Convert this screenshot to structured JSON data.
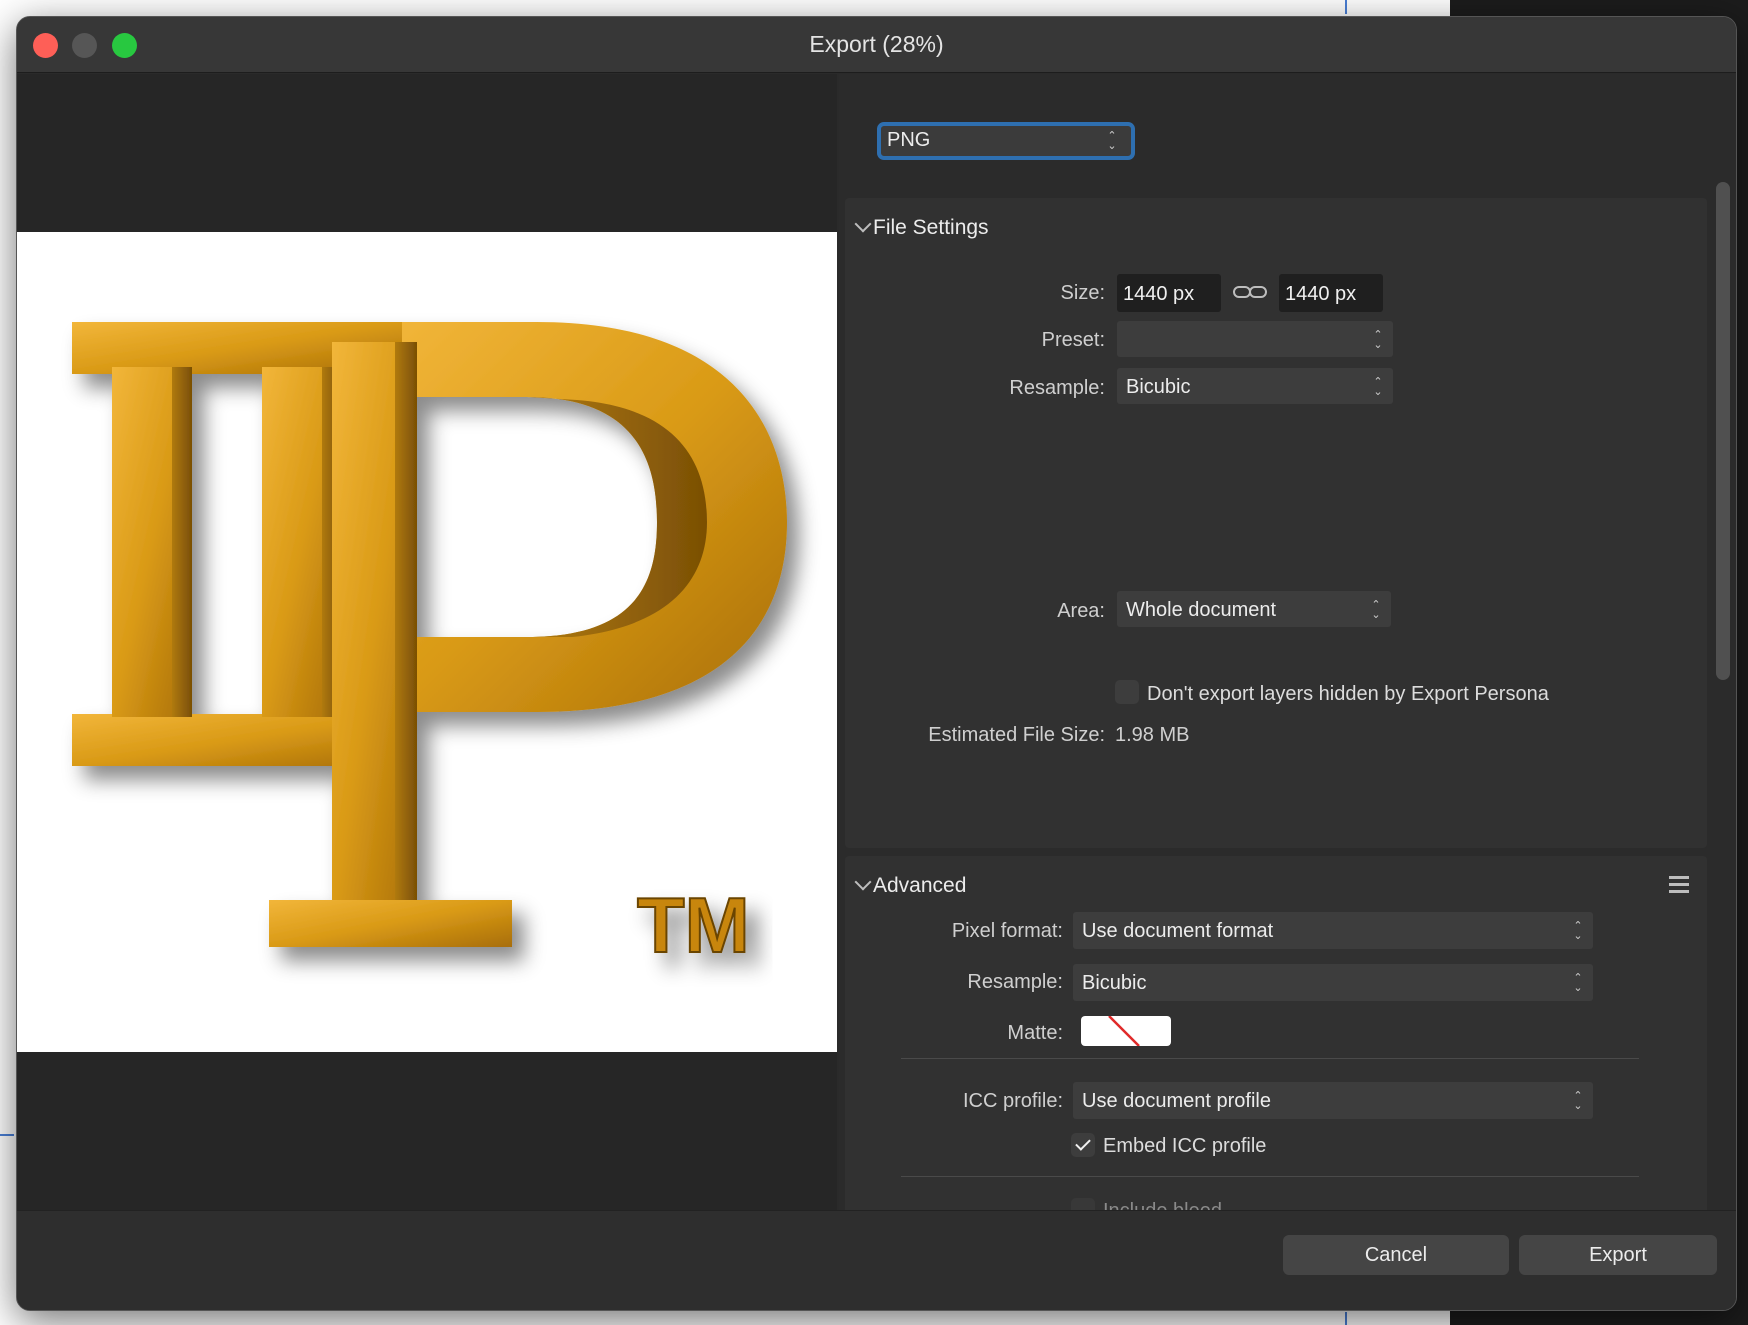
{
  "window": {
    "title": "Export (28%)"
  },
  "preview": {
    "logo_letters": "IP",
    "trademark": "TM"
  },
  "format": {
    "selected": "PNG"
  },
  "file_settings": {
    "title": "File Settings",
    "size_label": "Size:",
    "width": "1440 px",
    "height": "1440 px",
    "preset_label": "Preset:",
    "preset_value": "",
    "resample_label": "Resample:",
    "resample_value": "Bicubic",
    "area_label": "Area:",
    "area_value": "Whole document",
    "hidden_layers_label": "Don't export layers hidden by Export Persona",
    "hidden_layers_checked": false,
    "estimated_label": "Estimated File Size:",
    "estimated_value": "1.98 MB"
  },
  "advanced": {
    "title": "Advanced",
    "pixel_format_label": "Pixel format:",
    "pixel_format_value": "Use document format",
    "resample_label": "Resample:",
    "resample_value": "Bicubic",
    "matte_label": "Matte:",
    "icc_label": "ICC profile:",
    "icc_value": "Use document profile",
    "embed_icc_label": "Embed ICC profile",
    "embed_icc_checked": true,
    "include_bleed_label": "Include bleed",
    "include_bleed_checked": false
  },
  "footer": {
    "cancel_label": "Cancel",
    "export_label": "Export"
  },
  "colors": {
    "accent": "#2e6fb0",
    "close": "#fe5f57",
    "zoom": "#28c840",
    "logo_gold": "#d4a017"
  }
}
